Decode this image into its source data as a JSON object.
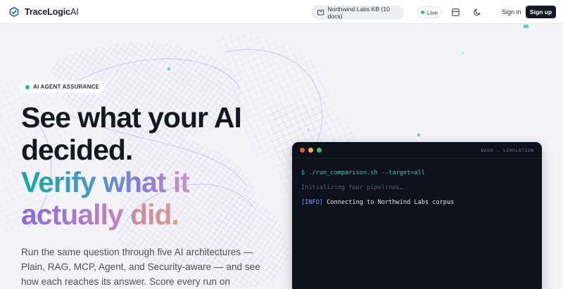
{
  "header": {
    "brand_name": "TraceLogic",
    "brand_suffix": "AI",
    "knowledge_base": "Northwind Labs KB (10 docs)",
    "live_label": "Live",
    "signin_label": "Sign in",
    "signup_label": "Sign up"
  },
  "hero": {
    "badge": "AI AGENT ASSURANCE",
    "headline_line1": "See what your AI",
    "headline_line2": "decided.",
    "headline_line3": "Verify what it",
    "headline_line4": "actually did.",
    "lede": "Run the same question through five AI architectures — Plain, RAG, MCP, Agent, and Security-aware — and see how each reaches its answer. Score every run on"
  },
  "terminal": {
    "title": "BASH — SIMULATION",
    "line1": "$ ./run_comparison.sh --target=all",
    "line2": "Initializing four pipelines…",
    "line3_tag": "[INFO]",
    "line3_text": " Connecting to Northwind Labs corpus"
  },
  "icons": {
    "brand": "shield-check-icon",
    "kb": "folder-icon",
    "layout": "layout-icon",
    "theme": "moon-icon"
  },
  "colors": {
    "accent_teal": "#19b89a",
    "live_green": "#21c18c",
    "terminal_bg": "#0c111c",
    "signup_bg": "#141722"
  }
}
